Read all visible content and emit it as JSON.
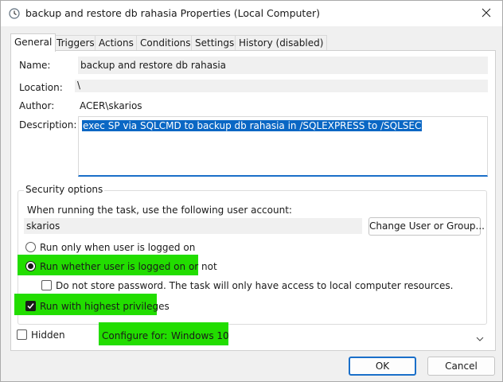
{
  "window": {
    "title": "backup and restore db rahasia Properties (Local Computer)",
    "accent_color": "#1a6fc9",
    "highlight_color": "#22dd00"
  },
  "tabs": [
    {
      "label": "General",
      "active": true
    },
    {
      "label": "Triggers"
    },
    {
      "label": "Actions"
    },
    {
      "label": "Conditions"
    },
    {
      "label": "Settings"
    },
    {
      "label": "History (disabled)"
    }
  ],
  "general": {
    "name_label": "Name:",
    "name_value": "backup and restore db rahasia",
    "location_label": "Location:",
    "location_value": "\\",
    "author_label": "Author:",
    "author_value": "ACER\\skarios",
    "description_label": "Description:",
    "description_value": "exec SP via SQLCMD to backup db rahasia in /SQLEXPRESS to /SQLSEC"
  },
  "security": {
    "group_title": "Security options",
    "account_prompt": "When running the task, use the following user account:",
    "account_value": "skarios",
    "change_button": "Change User or Group...",
    "radio_logged_on": "Run only when user is logged on",
    "radio_whether": "Run whether user is logged on or not",
    "radio_selected": "whether",
    "no_store_password": "Do not store password.  The task will only have access to local computer resources.",
    "no_store_password_checked": false,
    "highest_privileges": "Run with highest privileges",
    "highest_privileges_checked": true
  },
  "bottom": {
    "hidden_label": "Hidden",
    "hidden_checked": false,
    "configure_label": "Configure for:",
    "configure_value": "Windows 10"
  },
  "footer": {
    "ok_label": "OK",
    "cancel_label": "Cancel"
  }
}
